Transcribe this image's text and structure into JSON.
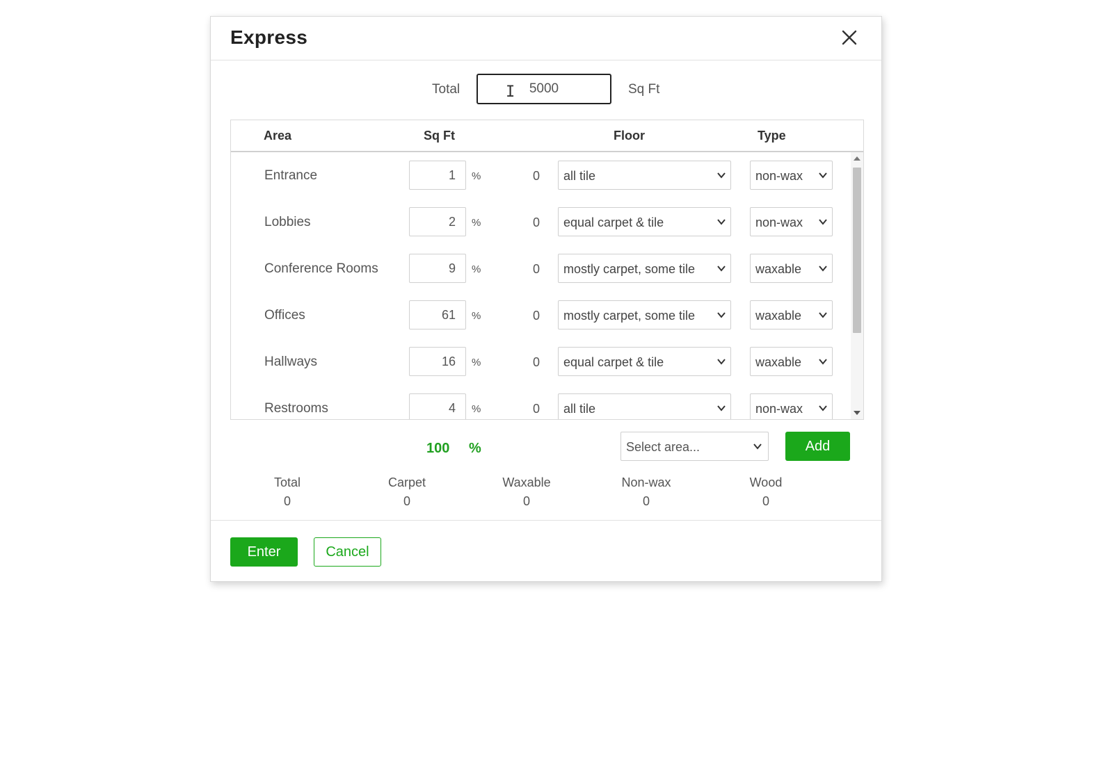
{
  "dialog": {
    "title": "Express",
    "close_icon": "close-icon",
    "total_label": "Total",
    "total_value": "5000",
    "total_unit": "Sq Ft"
  },
  "table": {
    "headers": {
      "area": "Area",
      "sqft": "Sq Ft",
      "floor": "Floor",
      "type": "Type"
    },
    "percent_sign": "%",
    "rows": [
      {
        "area": "Entrance",
        "pct": "1",
        "sqft": "0",
        "floor": "all tile",
        "type": "non-wax"
      },
      {
        "area": "Lobbies",
        "pct": "2",
        "sqft": "0",
        "floor": "equal carpet & tile",
        "type": "non-wax"
      },
      {
        "area": "Conference Rooms",
        "pct": "9",
        "sqft": "0",
        "floor": "mostly carpet, some tile",
        "type": "waxable"
      },
      {
        "area": "Offices",
        "pct": "61",
        "sqft": "0",
        "floor": "mostly carpet, some tile",
        "type": "waxable"
      },
      {
        "area": "Hallways",
        "pct": "16",
        "sqft": "0",
        "floor": "equal carpet & tile",
        "type": "waxable"
      },
      {
        "area": "Restrooms",
        "pct": "4",
        "sqft": "0",
        "floor": "all tile",
        "type": "non-wax"
      }
    ]
  },
  "summary": {
    "pct_total": "100",
    "pct_sign": "%",
    "select_area_placeholder": "Select area...",
    "add_label": "Add"
  },
  "stats": [
    {
      "label": "Total",
      "value": "0"
    },
    {
      "label": "Carpet",
      "value": "0"
    },
    {
      "label": "Waxable",
      "value": "0"
    },
    {
      "label": "Non-wax",
      "value": "0"
    },
    {
      "label": "Wood",
      "value": "0"
    }
  ],
  "footer": {
    "enter_label": "Enter",
    "cancel_label": "Cancel"
  },
  "colors": {
    "accent": "#1ba81b",
    "percent_total": "#21a021"
  }
}
